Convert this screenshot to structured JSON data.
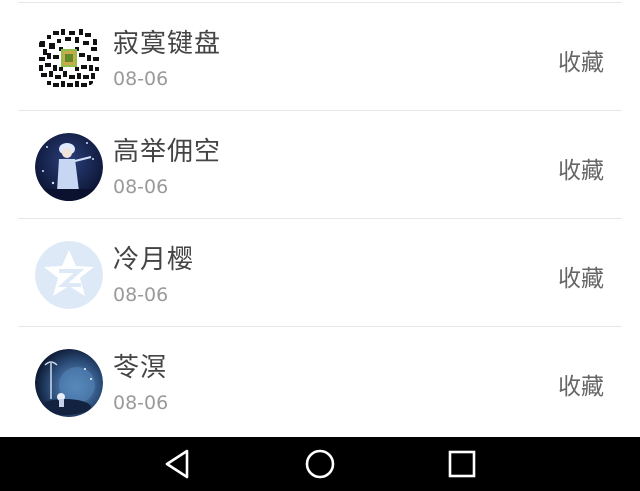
{
  "contacts": [
    {
      "name": "寂寞键盘",
      "date": "08-06",
      "action": "收藏",
      "avatar": "qr-code-avatar"
    },
    {
      "name": "高举佣空",
      "date": "08-06",
      "action": "收藏",
      "avatar": "anime-girl-avatar"
    },
    {
      "name": "冷月樱",
      "date": "08-06",
      "action": "收藏",
      "avatar": "qzone-logo-avatar"
    },
    {
      "name": "苓溟",
      "date": "08-06",
      "action": "收藏",
      "avatar": "night-scene-avatar"
    }
  ],
  "navbar": {
    "back": "back-triangle-icon",
    "home": "home-circle-icon",
    "recents": "recents-square-icon"
  },
  "colors": {
    "name_text": "#444444",
    "date_text": "#9a9a9a",
    "action_text": "#666666",
    "divider": "#e6e6e6",
    "navbar_bg": "#000000"
  }
}
